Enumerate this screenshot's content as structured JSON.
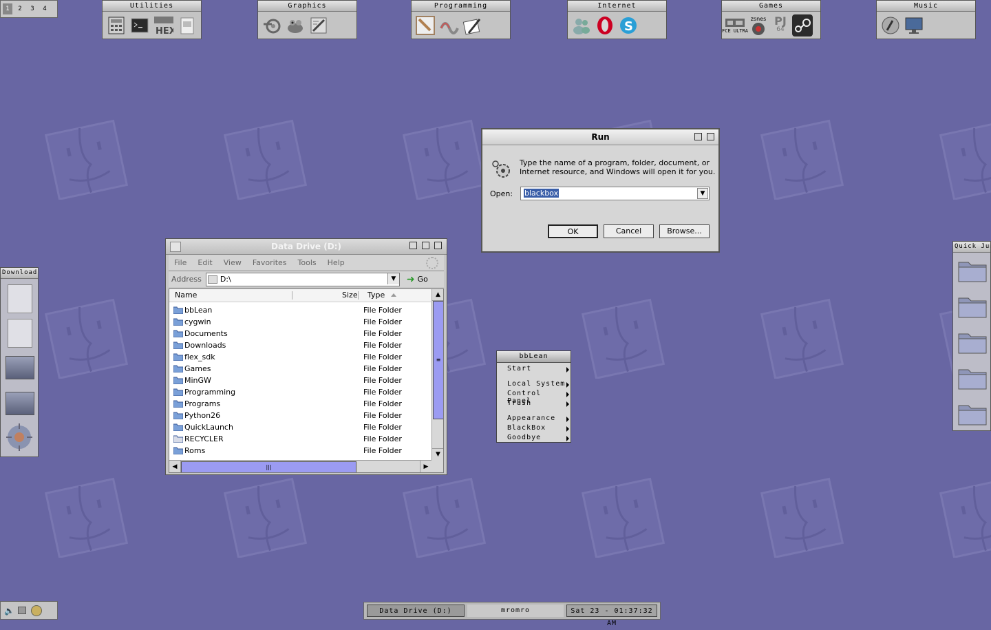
{
  "workspaces": [
    "1",
    "2",
    "3",
    "4"
  ],
  "slits": [
    {
      "label": "Utilities",
      "icons": [
        "calculator-icon",
        "terminal-icon",
        "hex-editor-icon",
        "notepad-icon"
      ]
    },
    {
      "label": "Graphics",
      "icons": [
        "blender-icon",
        "gimp-icon",
        "inkscape-icon"
      ]
    },
    {
      "label": "Programming",
      "icons": [
        "notepadpp-icon",
        "eclipse-icon",
        "editor-icon"
      ]
    },
    {
      "label": "Internet",
      "icons": [
        "messenger-icon",
        "opera-icon",
        "skype-icon"
      ]
    },
    {
      "label": "Games",
      "icons": [
        "fceultra-icon",
        "zsnes-icon",
        "pj64-icon",
        "steam-icon"
      ]
    },
    {
      "label": "Music",
      "icons": [
        "foobar-icon",
        "kmplayer-icon"
      ]
    }
  ],
  "games_text": {
    "fce": "FCE ULTRA",
    "zsnes": "zsnes",
    "pj": "PJ",
    "pj64": "64"
  },
  "left_slit": {
    "label": "Downloads"
  },
  "right_slit": {
    "label": "Quick Jump"
  },
  "explorer": {
    "title": "Data Drive (D:)",
    "menu": [
      "File",
      "Edit",
      "View",
      "Favorites",
      "Tools",
      "Help"
    ],
    "address_label": "Address",
    "address_value": "D:\\",
    "go_label": "Go",
    "columns": {
      "name": "Name",
      "size": "Size",
      "type": "Type"
    },
    "rows": [
      {
        "name": "bbLean",
        "type": "File Folder"
      },
      {
        "name": "cygwin",
        "type": "File Folder"
      },
      {
        "name": "Documents",
        "type": "File Folder"
      },
      {
        "name": "Downloads",
        "type": "File Folder"
      },
      {
        "name": "flex_sdk",
        "type": "File Folder"
      },
      {
        "name": "Games",
        "type": "File Folder"
      },
      {
        "name": "MinGW",
        "type": "File Folder"
      },
      {
        "name": "Programming",
        "type": "File Folder"
      },
      {
        "name": "Programs",
        "type": "File Folder"
      },
      {
        "name": "Python26",
        "type": "File Folder"
      },
      {
        "name": "QuickLaunch",
        "type": "File Folder"
      },
      {
        "name": "RECYCLER",
        "type": "File Folder"
      },
      {
        "name": "Roms",
        "type": "File Folder"
      }
    ]
  },
  "run": {
    "title": "Run",
    "desc_line1": "Type the name of a program, folder, document, or",
    "desc_line2": "Internet resource, and Windows will open it for you.",
    "open_label": "Open:",
    "open_value": "blackbox",
    "ok": "OK",
    "cancel": "Cancel",
    "browse": "Browse..."
  },
  "bbmenu": {
    "title": "bbLean",
    "items": [
      "Start",
      "Local System",
      "Control Panel",
      "Trash",
      "Appearance",
      "BlackBox",
      "Goodbye"
    ]
  },
  "toolbar": {
    "task": "Data Drive (D:)",
    "workspace": "mromro",
    "clock": "Sat 23 - 01:37:32 AM"
  },
  "colors": {
    "desktop": "#6866a3",
    "selection": "#3a5ea8",
    "scroll_accent": "#9b9bf2"
  }
}
